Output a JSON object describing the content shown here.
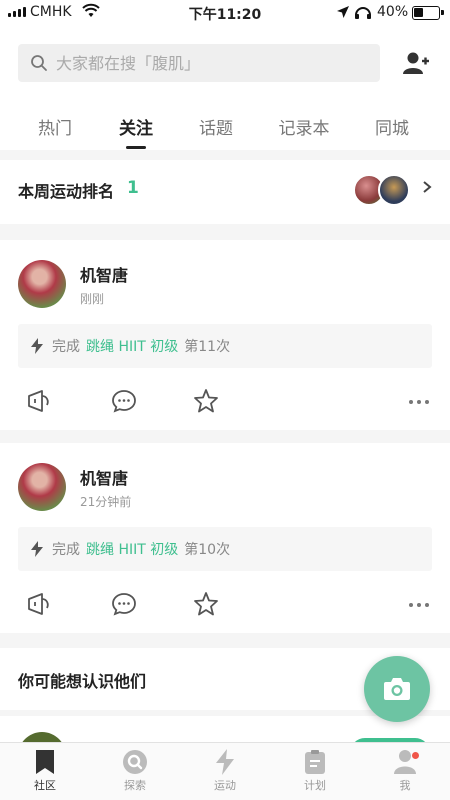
{
  "status_bar": {
    "carrier": "CMHK",
    "time": "下午11:20",
    "battery": "40%",
    "battery_level": 0.4
  },
  "search": {
    "placeholder": "大家都在搜「腹肌」"
  },
  "tabs": [
    {
      "label": "热门"
    },
    {
      "label": "关注",
      "active": true
    },
    {
      "label": "话题"
    },
    {
      "label": "记录本"
    },
    {
      "label": "同城"
    }
  ],
  "weekly_rank": {
    "label": "本周运动排名",
    "rank": "1"
  },
  "posts": [
    {
      "name": "机智唐",
      "time": "刚刚",
      "done_label": "完成",
      "course": "跳绳 HIIT 初级",
      "count": "第11次"
    },
    {
      "name": "机智唐",
      "time": "21分钟前",
      "done_label": "完成",
      "course": "跳绳 HIIT 初级",
      "count": "第10次"
    }
  ],
  "suggest": {
    "title": "你可能想认识他们"
  },
  "tabbar": [
    {
      "label": "社区",
      "icon": "bookmark-icon",
      "active": true
    },
    {
      "label": "探索",
      "icon": "explore-icon"
    },
    {
      "label": "运动",
      "icon": "bolt-icon"
    },
    {
      "label": "计划",
      "icon": "clipboard-icon"
    },
    {
      "label": "我",
      "icon": "profile-icon",
      "badge": true
    }
  ],
  "colors": {
    "accent": "#3fbf8f",
    "fab": "#6dc4a3",
    "badge": "#f0564a"
  }
}
